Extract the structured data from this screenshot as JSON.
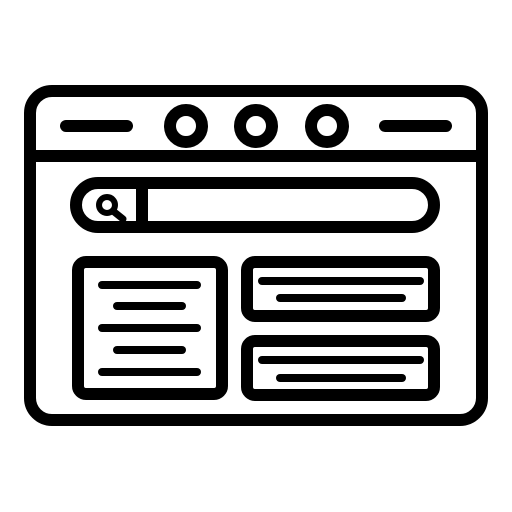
{
  "icon": {
    "name": "browser-window-search-layout-icon",
    "stroke_color": "#000000",
    "fill_color": "#ffffff"
  }
}
